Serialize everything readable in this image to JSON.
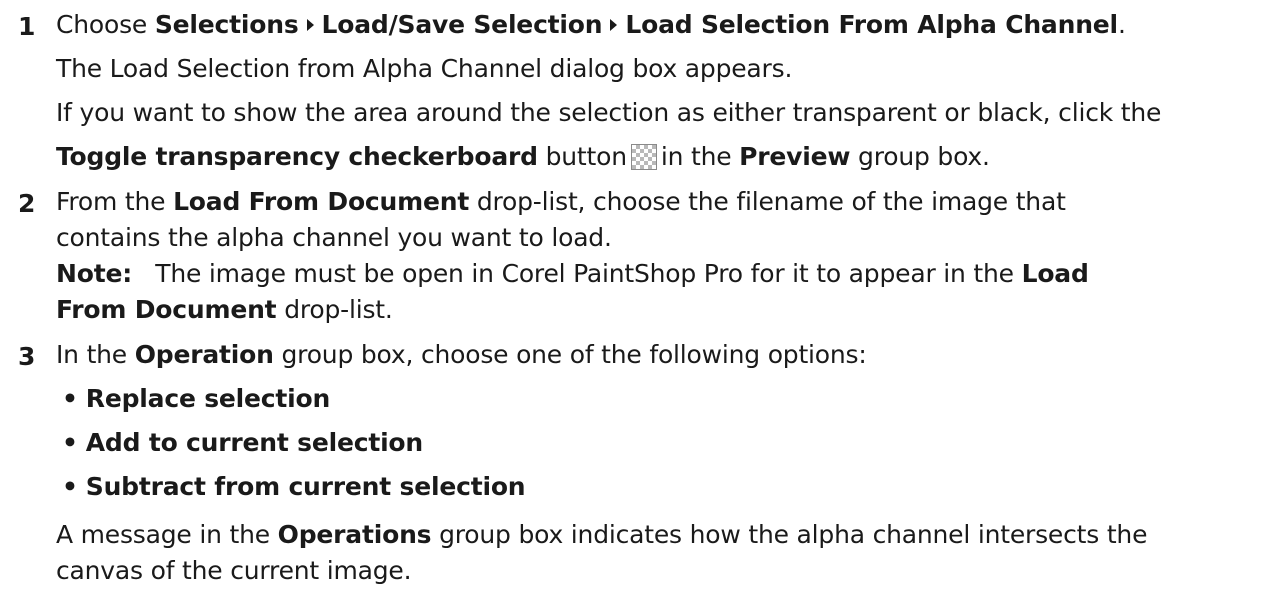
{
  "step1": {
    "number": "1",
    "choose_prefix": "Choose",
    "menu_path": [
      "Selections",
      "Load/Save Selection",
      "Load Selection From Alpha Channel"
    ],
    "period": ".",
    "appears_text": "The Load Selection from Alpha Channel dialog box appears.",
    "if_text": "If you want to show the area around the selection as either transparent or black, click the",
    "toggle_label": "Toggle transparency checkerboard",
    "button_text": "button",
    "in_the_text": "in the",
    "preview_label": "Preview",
    "group_box_text": "group box.",
    "checker_icon": "transparency-checkerboard-icon"
  },
  "step2": {
    "number": "2",
    "from_the": "From the",
    "load_from_document": "Load From Document",
    "rest_line1": "drop-list, choose the filename of the image that",
    "line2": "contains the alpha channel you want to load.",
    "note_label": "Note:",
    "note_text": "The image must be open in Corel PaintShop Pro for it to appear in the",
    "note_bold_load": "Load",
    "note_bold_from_document": "From Document",
    "note_end": "drop-list."
  },
  "step3": {
    "number": "3",
    "in_the": "In the",
    "operation_label": "Operation",
    "rest_line": "group box, choose one of the following options:",
    "bullet_char": "•",
    "options": [
      "Replace selection",
      "Add to current selection",
      "Subtract from current selection"
    ],
    "message_prefix": "A message in the",
    "operations_label": "Operations",
    "message_rest": "group box indicates how the alpha channel intersects the",
    "message_line2": "canvas of the current image."
  }
}
